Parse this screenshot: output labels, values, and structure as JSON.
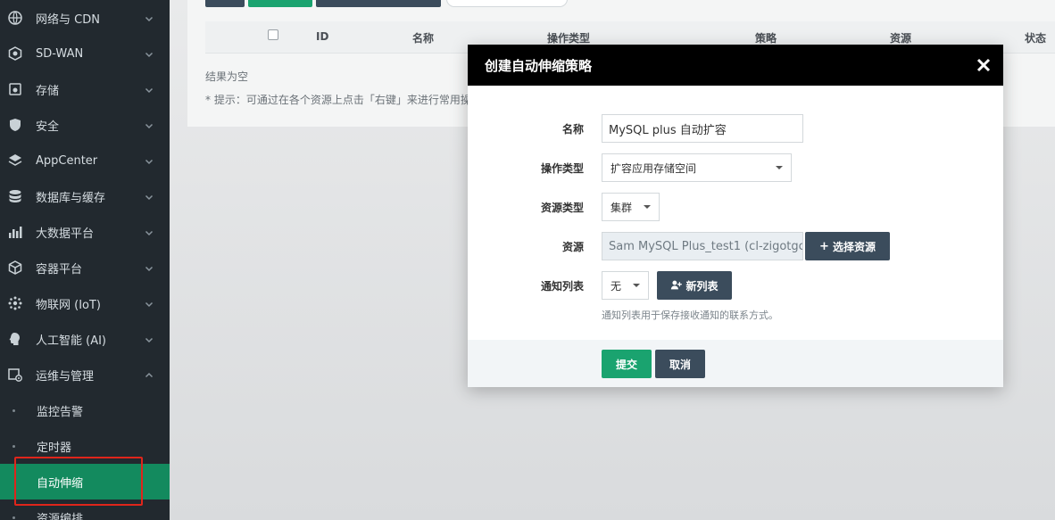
{
  "sidebar": {
    "items": [
      {
        "label": "网络与 CDN",
        "icon": "globe-icon"
      },
      {
        "label": "SD-WAN",
        "icon": "network-icon"
      },
      {
        "label": "存储",
        "icon": "storage-icon"
      },
      {
        "label": "安全",
        "icon": "shield-icon"
      },
      {
        "label": "AppCenter",
        "icon": "layers-icon"
      },
      {
        "label": "数据库与缓存",
        "icon": "database-icon"
      },
      {
        "label": "大数据平台",
        "icon": "bar-chart-icon"
      },
      {
        "label": "容器平台",
        "icon": "cube-icon"
      },
      {
        "label": "物联网 (IoT)",
        "icon": "iot-icon"
      },
      {
        "label": "人工智能 (AI)",
        "icon": "ai-head-icon"
      },
      {
        "label": "运维与管理",
        "icon": "ops-gear-icon"
      }
    ],
    "sub_items": [
      {
        "label": "监控告警"
      },
      {
        "label": "定时器"
      },
      {
        "label": "自动伸缩",
        "active": true
      },
      {
        "label": "资源编排"
      }
    ]
  },
  "table": {
    "headers": {
      "id": "ID",
      "name": "名称",
      "op_type": "操作类型",
      "policy": "策略",
      "resource": "资源",
      "status": "状态"
    },
    "empty_text": "结果为空",
    "tip": "* 提示：可通过在各个资源上点击「右键」来进行常用操"
  },
  "modal": {
    "title": "创建自动伸缩策略",
    "fields": {
      "name_label": "名称",
      "name_value": "MySQL plus 自动扩容",
      "op_type_label": "操作类型",
      "op_type_value": "扩容应用存储空间",
      "res_type_label": "资源类型",
      "res_type_value": "集群",
      "resource_label": "资源",
      "resource_value": "Sam MySQL Plus_test1 (cl-zigotgc",
      "select_resource_button": "选择资源",
      "notify_label": "通知列表",
      "notify_value": "无",
      "new_list_button": "新列表",
      "notify_hint": "通知列表用于保存接收通知的联系方式。"
    },
    "footer": {
      "submit": "提交",
      "cancel": "取消"
    }
  },
  "colors": {
    "sidebar_bg": "#22292f",
    "active_green": "#138a5e",
    "primary_green": "#1aa36f",
    "dark_button": "#3b4c5c",
    "highlight_red": "#e0251b"
  }
}
